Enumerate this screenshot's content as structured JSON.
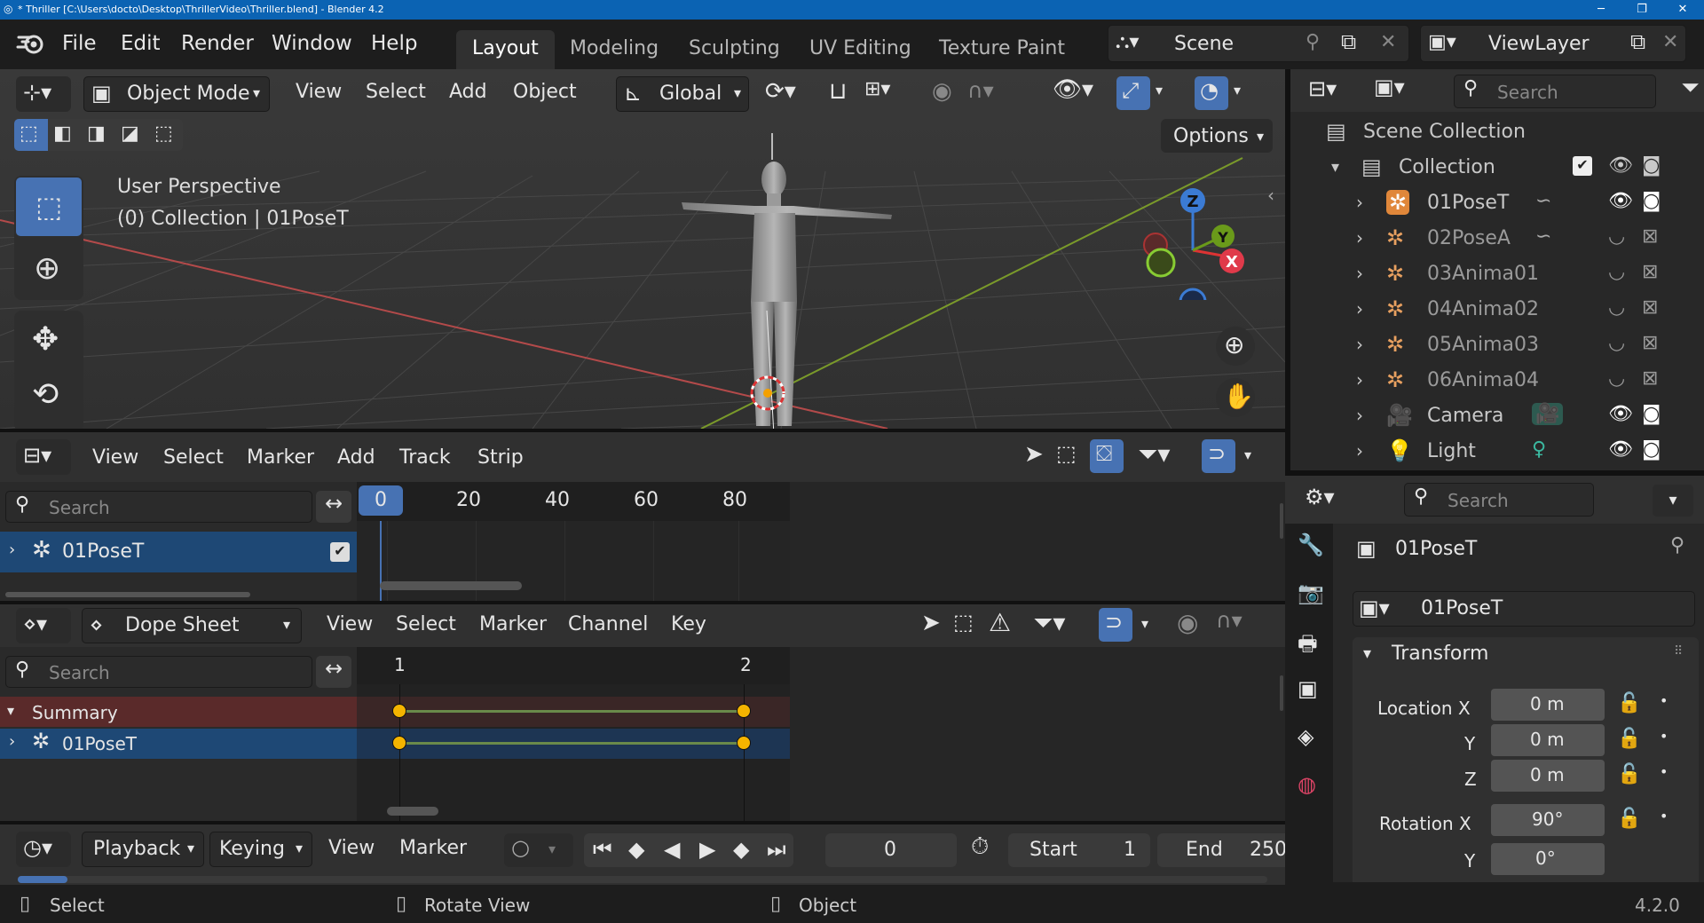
{
  "window": {
    "title": "* Thriller [C:\\Users\\docto\\Desktop\\ThrillerVideo\\Thriller.blend] - Blender 4.2",
    "min": "─",
    "max": "❐",
    "close": "✕"
  },
  "menu": [
    "File",
    "Edit",
    "Render",
    "Window",
    "Help"
  ],
  "workspaces": [
    "Layout",
    "Modeling",
    "Sculpting",
    "UV Editing",
    "Texture Paint"
  ],
  "scene": {
    "name": "Scene",
    "view_layer": "ViewLayer"
  },
  "viewport": {
    "mode": "Object Mode",
    "menus": [
      "View",
      "Select",
      "Add",
      "Object"
    ],
    "orientation": "Global",
    "options": "Options",
    "info_line1": "User Perspective",
    "info_line2": "(0) Collection | 01PoseT",
    "gizmo": {
      "z": "Z",
      "y": "Y",
      "x": "X"
    }
  },
  "nla": {
    "menus": [
      "View",
      "Select",
      "Marker",
      "Add",
      "Track",
      "Strip"
    ],
    "search_placeholder": "Search",
    "frames": [
      "0",
      "20",
      "40",
      "60",
      "80"
    ],
    "track": "01PoseT"
  },
  "dopesheet": {
    "mode": "Dope Sheet",
    "menus": [
      "View",
      "Select",
      "Marker",
      "Channel",
      "Key"
    ],
    "search_placeholder": "Search",
    "frames": [
      "1",
      "2"
    ],
    "summary": "Summary",
    "channel": "01PoseT"
  },
  "timeline": {
    "menus": [
      "Playback",
      "Keying",
      "View",
      "Marker"
    ],
    "current_frame": "0",
    "start_label": "Start",
    "start": "1",
    "end_label": "End",
    "end": "250"
  },
  "outliner": {
    "search_placeholder": "Search",
    "scene_collection": "Scene Collection",
    "collection": "Collection",
    "items": [
      {
        "name": "01PoseT",
        "type": "armature",
        "visible": true
      },
      {
        "name": "02PoseA",
        "type": "armature",
        "visible": false
      },
      {
        "name": "03Anima01",
        "type": "armature",
        "visible": false
      },
      {
        "name": "04Anima02",
        "type": "armature",
        "visible": false
      },
      {
        "name": "05Anima03",
        "type": "armature",
        "visible": false
      },
      {
        "name": "06Anima04",
        "type": "armature",
        "visible": false
      },
      {
        "name": "Camera",
        "type": "camera",
        "visible": true
      },
      {
        "name": "Light",
        "type": "light",
        "visible": true
      }
    ]
  },
  "properties": {
    "search_placeholder": "Search",
    "object_name": "01PoseT",
    "datablock": "01PoseT",
    "panel": "Transform",
    "location_x_label": "Location X",
    "y_label": "Y",
    "z_label": "Z",
    "location_x": "0 m",
    "location_y": "0 m",
    "location_z": "0 m",
    "rotation_x_label": "Rotation X",
    "rotation_x": "90°",
    "rotation_y_label": "Y",
    "rotation_y": "0°"
  },
  "statusbar": {
    "select": "Select",
    "rotate": "Rotate View",
    "object": "Object",
    "version": "4.2.0"
  },
  "colors": {
    "accent": "#4772b3",
    "selected_row": "#1e4875",
    "summary_row": "#5a2a2a",
    "keyframe": "#f4b400"
  }
}
